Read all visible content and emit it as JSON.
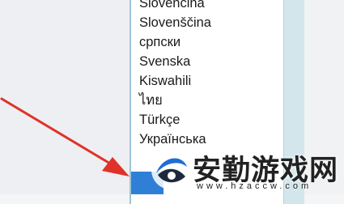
{
  "language_list": {
    "items": [
      "Slovenčina",
      "Slovenščina",
      "српски",
      "Svenska",
      "Kiswahili",
      "ไทย",
      "Türkçe",
      "Українська"
    ]
  },
  "watermark": {
    "title": "安勤游戏网",
    "url": "www.hzaccw.com"
  },
  "colors": {
    "arrow": "#e0322b",
    "selection": "#2f7fd6",
    "scrollbar": "#d3e6ec"
  }
}
